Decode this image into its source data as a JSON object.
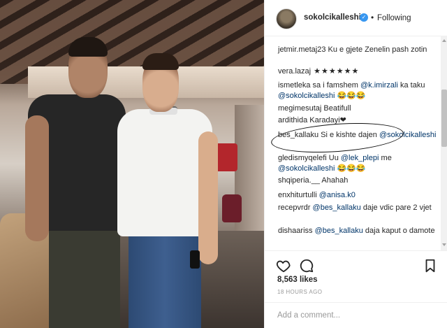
{
  "post": {
    "username": "sokolcikalleshi",
    "verified_icon": "check-badge-icon",
    "separator": "•",
    "follow_status": "Following"
  },
  "comments": [
    {
      "user": "jetmir.metaj23",
      "text": " Ku e gjete Zenelin pash zotin",
      "mention": ""
    },
    {
      "user": "vera.lazaj",
      "text": " ★★★★★★",
      "mention": ""
    },
    {
      "user": "ismetleka",
      "text": " sa i famshem ",
      "mention": "@k.imirzali",
      "after": " ka taku ",
      "mention2": "@sokolcikalleshi",
      "after2": " 😂😂😂"
    },
    {
      "user": "megimesutaj",
      "text": " Beatifull",
      "mention": ""
    },
    {
      "user": "ardithida",
      "text": " Karadayi❤",
      "mention": ""
    },
    {
      "user": "bes_kallaku",
      "text": " Si e kishte dajen ",
      "mention": "@sokolcikalleshi"
    },
    {
      "user": "gledismyqelefi",
      "text": " Uu ",
      "mention": "@lek_plepi",
      "after": " me ",
      "mention2": "@sokolcikalleshi",
      "after2": " 😂😂😂"
    },
    {
      "user": "shqiperia.__",
      "text": " Ahahah",
      "mention": ""
    },
    {
      "user": "enxhiturtulli",
      "text": " ",
      "mention": "@anisa.k0"
    },
    {
      "user": "recepvrdr",
      "text": " ",
      "mention": "@bes_kallaku",
      "after": " daje vdic pare 2 vjet"
    },
    {
      "user": "dishaariss",
      "text": " ",
      "mention": "@bes_kallaku",
      "after": " daja kaput o damote"
    }
  ],
  "likes": "8,563 likes",
  "timestamp": "18 HOURS AGO",
  "add_comment_placeholder": "Add a comment...",
  "icons": {
    "like": "heart-icon",
    "comment": "comment-bubble-icon",
    "save": "bookmark-icon"
  }
}
